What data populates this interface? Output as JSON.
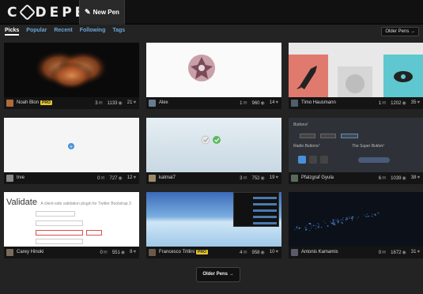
{
  "header": {
    "logo_text": "CODEPEN",
    "new_pen_label": "New Pen"
  },
  "nav": {
    "tabs": [
      "Picks",
      "Popular",
      "Recent",
      "Following",
      "Tags"
    ],
    "active_tab": "Picks",
    "older_label": "Older Pens →"
  },
  "cards": [
    {
      "author": "Noah Blon",
      "pro": true,
      "comments": "3",
      "views": "1133",
      "hearts": "21"
    },
    {
      "author": "Alex",
      "pro": false,
      "comments": "1",
      "views": "960",
      "hearts": "14"
    },
    {
      "author": "Timo Hausmann",
      "pro": false,
      "comments": "1",
      "views": "1202",
      "hearts": "35"
    },
    {
      "author": "trve",
      "pro": false,
      "comments": "0",
      "views": "727",
      "hearts": "12"
    },
    {
      "author": "katmai7",
      "pro": false,
      "comments": "3",
      "views": "752",
      "hearts": "19"
    },
    {
      "author": "Pfalzgraf Gyula",
      "pro": false,
      "comments": "6",
      "views": "1039",
      "hearts": "38"
    },
    {
      "author": "Carey Hinoki",
      "pro": false,
      "comments": "0",
      "views": "551",
      "hearts": "8"
    },
    {
      "author": "Francesco Trillini",
      "pro": true,
      "comments": "4",
      "views": "958",
      "hearts": "10"
    },
    {
      "author": "Antonis Kamamis",
      "pro": false,
      "comments": "0",
      "views": "1672",
      "hearts": "31"
    }
  ],
  "thumbs": {
    "validate_title": "Validate",
    "validate_sub": "A client-side validation plugin for Twitter Bootstrap 3",
    "button_demo_title": "Buttons!",
    "button_demo_sub1": "Radio Buttons!",
    "button_demo_sub2": "The Super Button!"
  },
  "pro_label": "PRO",
  "older_bottom_label": "Older Pens →",
  "colors": {
    "background": "#232323",
    "header": "#111111",
    "tab_link": "#6ca5d8",
    "pro_badge": "#e8c62c"
  }
}
